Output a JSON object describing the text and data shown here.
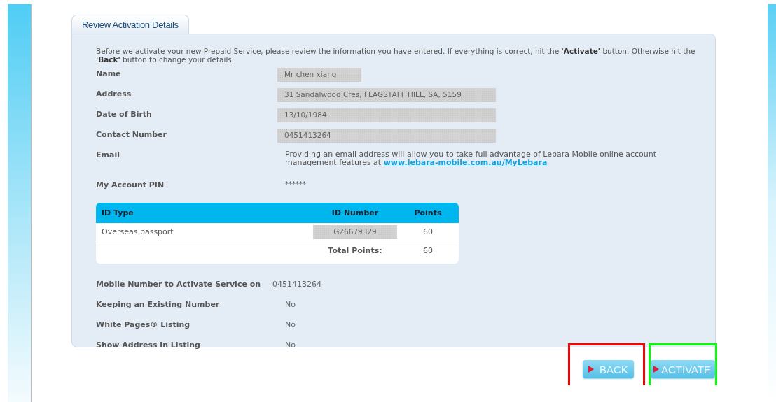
{
  "tab": {
    "label": "Review Activation Details",
    "selected": true
  },
  "intro": "Before we activate your new Prepaid Service, please review the information you have entered. If everything is correct, hit the **'Activate'** button. Otherwise hit the **'Back'** button to change your details.",
  "details": [
    {
      "label": "Name",
      "value": "Mr chen xiang",
      "kind": "masked",
      "wide": false
    },
    {
      "label": "Address",
      "value": "31 Sandalwood Cres, FLAGSTAFF HILL, SA, 5159",
      "kind": "masked",
      "wide": true
    },
    {
      "label": "Date of Birth",
      "value": "13/10/1984",
      "kind": "masked",
      "wide": true
    },
    {
      "label": "Contact Number",
      "value": "0451413264",
      "kind": "masked",
      "wide": true
    },
    {
      "label": "Email",
      "value": "Providing an email address will allow you to take full advantage of Lebara Mobile online account management features at",
      "link": "www.lebara-mobile.com.au/MyLebara",
      "kind": "note"
    },
    {
      "label": "My Account PIN",
      "value": "******",
      "kind": "plain"
    }
  ],
  "id_table": {
    "columns": [
      "ID Type",
      "ID Number",
      "Points"
    ],
    "rows": [
      {
        "id_type": "Overseas passport",
        "id_number": "G26679329",
        "points": "60"
      }
    ],
    "total_label": "Total Points:",
    "total": "60"
  },
  "service": [
    {
      "label": "Mobile Number to Activate Service on",
      "value": "0451413264"
    },
    {
      "label": "Keeping an Existing Number",
      "value": "No"
    },
    {
      "label": "White Pages® Listing",
      "value": "No"
    },
    {
      "label": "Show Address in Listing",
      "value": "No"
    }
  ],
  "buttons": [
    {
      "label": "BACK",
      "color": "#ff0000"
    },
    {
      "label": "ACTIVATE",
      "color": "#00ff00"
    }
  ]
}
